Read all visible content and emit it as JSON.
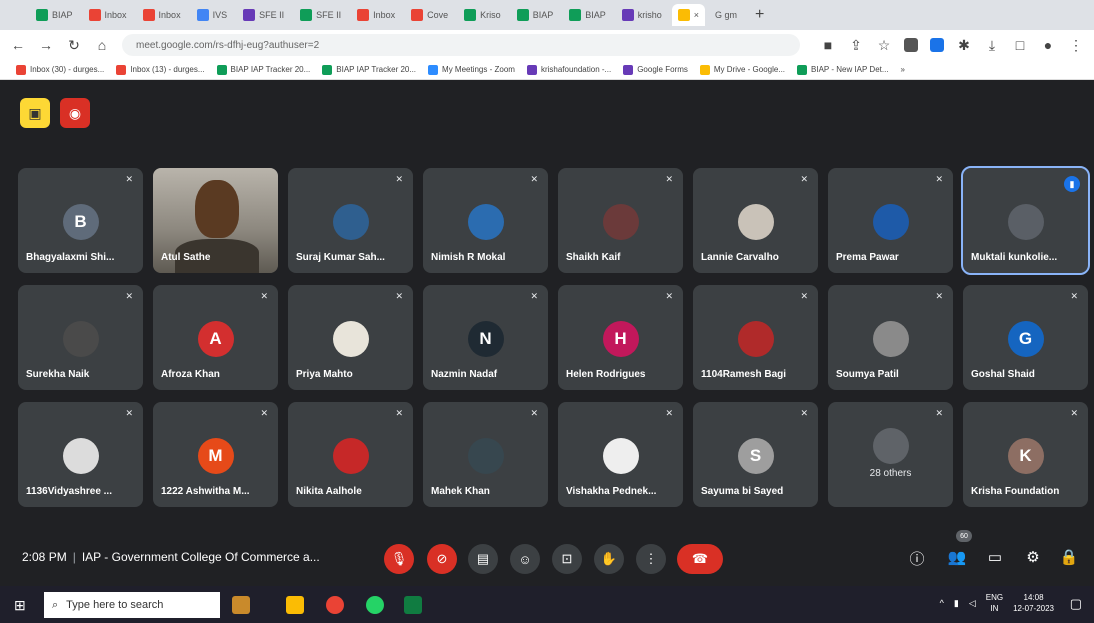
{
  "browser": {
    "tabs": [
      {
        "label": "BIAP",
        "color": "#0f9d58"
      },
      {
        "label": "Inbox",
        "color": "#ea4335"
      },
      {
        "label": "Inbox",
        "color": "#ea4335"
      },
      {
        "label": "IVS",
        "color": "#4285f4"
      },
      {
        "label": "SFE II",
        "color": "#673ab7"
      },
      {
        "label": "SFE II",
        "color": "#0f9d58"
      },
      {
        "label": "Inbox",
        "color": "#ea4335"
      },
      {
        "label": "Cove",
        "color": "#ea4335"
      },
      {
        "label": "Kriso",
        "color": "#0f9d58"
      },
      {
        "label": "BIAP",
        "color": "#0f9d58"
      },
      {
        "label": "BIAP",
        "color": "#0f9d58"
      },
      {
        "label": "krisho",
        "color": "#673ab7"
      }
    ],
    "active_tab": {
      "label": "",
      "color": "#fbbc04"
    },
    "google_tab": {
      "label": "G  gm",
      "color": "#4285f4"
    },
    "url": "meet.google.com/rs-dfhj-eug?authuser=2",
    "bookmarks": [
      {
        "label": "Inbox (30) - durges...",
        "color": "#ea4335"
      },
      {
        "label": "Inbox (13) - durges...",
        "color": "#ea4335"
      },
      {
        "label": "BIAP IAP Tracker 20...",
        "color": "#0f9d58"
      },
      {
        "label": "BIAP IAP Tracker 20...",
        "color": "#0f9d58"
      },
      {
        "label": "My Meetings - Zoom",
        "color": "#2d8cff"
      },
      {
        "label": "krishafoundation -...",
        "color": "#673ab7"
      },
      {
        "label": "Google Forms",
        "color": "#673ab7"
      },
      {
        "label": "My Drive - Google...",
        "color": "#fbbc04"
      },
      {
        "label": "BIAP - New IAP Det...",
        "color": "#0f9d58"
      }
    ],
    "bookmarks_more": "»"
  },
  "participants": [
    {
      "name": "Bhagyalaxmi Shi...",
      "initial": "B",
      "color": "#5f6b7a",
      "kind": "letter"
    },
    {
      "name": "Atul Sathe",
      "initial": "",
      "color": "#8c877e",
      "kind": "video"
    },
    {
      "name": "Suraj Kumar Sah...",
      "initial": "",
      "color": "#2f5f8f",
      "kind": "photo"
    },
    {
      "name": "Nimish R Mokal",
      "initial": "",
      "color": "#2b6cb0",
      "kind": "photo"
    },
    {
      "name": "Shaikh Kaif",
      "initial": "",
      "color": "#6b3a3a",
      "kind": "photo"
    },
    {
      "name": "Lannie Carvalho",
      "initial": "",
      "color": "#c9c2b8",
      "kind": "photo"
    },
    {
      "name": "Prema Pawar",
      "initial": "",
      "color": "#1e5aa8",
      "kind": "photo"
    },
    {
      "name": "Muktali kunkolie...",
      "initial": "",
      "color": "#5a5f66",
      "kind": "photo"
    },
    {
      "name": "Surekha Naik",
      "initial": "",
      "color": "#4a4a4a",
      "kind": "photo"
    },
    {
      "name": "Afroza Khan",
      "initial": "A",
      "color": "#d32f2f",
      "kind": "letter"
    },
    {
      "name": "Priya Mahto",
      "initial": "",
      "color": "#e8e4da",
      "kind": "photo"
    },
    {
      "name": "Nazmin Nadaf",
      "initial": "N",
      "color": "#1f2a33",
      "kind": "letter"
    },
    {
      "name": "Helen Rodrigues",
      "initial": "H",
      "color": "#c2185b",
      "kind": "letter"
    },
    {
      "name": "1104Ramesh Bagi",
      "initial": "",
      "color": "#b02a2a",
      "kind": "photo"
    },
    {
      "name": "Soumya Patil",
      "initial": "",
      "color": "#8a8a8a",
      "kind": "photo"
    },
    {
      "name": "Goshal Shaid",
      "initial": "G",
      "color": "#1565c0",
      "kind": "letter"
    },
    {
      "name": "1136Vidyashree ...",
      "initial": "",
      "color": "#dcdcdc",
      "kind": "photo"
    },
    {
      "name": "1222 Ashwitha M...",
      "initial": "M",
      "color": "#e64a19",
      "kind": "letter"
    },
    {
      "name": "Nikita Aalhole",
      "initial": "",
      "color": "#c62828",
      "kind": "photo"
    },
    {
      "name": "Mahek Khan",
      "initial": "",
      "color": "#37474f",
      "kind": "photo"
    },
    {
      "name": "Vishakha Pednek...",
      "initial": "",
      "color": "#eeeeee",
      "kind": "photo"
    },
    {
      "name": "Sayuma bi Sayed",
      "initial": "S",
      "color": "#9e9e9e",
      "kind": "letter"
    },
    {
      "name": "",
      "initial": "",
      "color": "#3c4043",
      "kind": "others",
      "others_label": "28 others"
    },
    {
      "name": "Krisha Foundation",
      "initial": "K",
      "color": "#8d6e63",
      "kind": "letter"
    }
  ],
  "meeting": {
    "time": "2:08 PM",
    "title": "IAP - Government College Of Commerce a...",
    "participant_count": "60"
  },
  "taskbar": {
    "search_placeholder": "Type here to search",
    "lang_top": "ENG",
    "lang_bottom": "IN",
    "clock_time": "14:08",
    "clock_date": "12-07-2023"
  }
}
